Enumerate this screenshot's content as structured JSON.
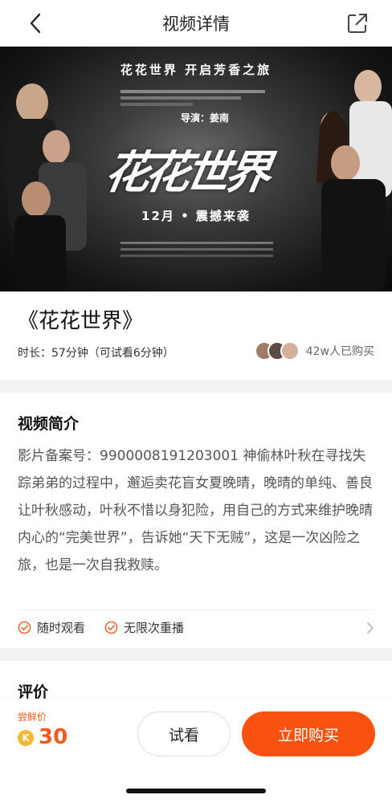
{
  "nav": {
    "title": "视频详情",
    "back_icon": "chevron-left-icon",
    "share_icon": "share-external-icon"
  },
  "poster": {
    "tagline": "花花世界 开启芳香之旅",
    "director": "导演：姜南",
    "logo_text": "花花世界",
    "release": "12月 • 震撼来袭"
  },
  "film": {
    "title": "《花花世界》",
    "duration": "时长：57分钟（可试看6分钟）",
    "buyers": "42w人已购买"
  },
  "intro": {
    "heading": "视频简介",
    "text": "影片备案号：9900008191203001 神偷林叶秋在寻找失踪弟弟的过程中，邂逅卖花盲女夏晚晴，晚晴的单纯、善良让叶秋感动，叶秋不惜以身犯险，用自己的方式来维护晚晴内心的“完美世界”，告诉她“天下无贼”，这是一次凶险之旅，也是一次自我救赎。",
    "features": [
      "随时观看",
      "无限次重播"
    ]
  },
  "review": {
    "heading": "评价"
  },
  "purchase": {
    "price_label": "尝鲜价",
    "coin_symbol": "K",
    "price": "30",
    "trial_label": "试看",
    "buy_label": "立即购买"
  },
  "colors": {
    "accent": "#f9510f",
    "price": "#f05a1a",
    "coin": "#f7b733"
  }
}
